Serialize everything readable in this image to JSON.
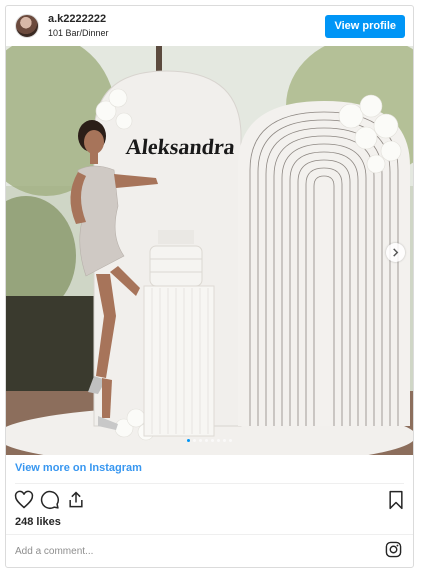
{
  "header": {
    "username": "a.k2222222",
    "subtitle": "101 Bar/Dinner",
    "view_profile_label": "View profile"
  },
  "media": {
    "overlay_text": "Aleksandra",
    "carousel_dots": 8,
    "active_dot": 1
  },
  "footer": {
    "view_more_label": "View more on Instagram",
    "likes_label": "248 likes",
    "comment_placeholder": "Add a comment..."
  },
  "icons": {
    "avatar": "avatar",
    "next": "chevron-right-icon",
    "like": "heart-icon",
    "comment": "comment-icon",
    "share": "share-icon",
    "save": "bookmark-icon",
    "logo": "instagram-icon"
  },
  "colors": {
    "accent": "#0095f6",
    "link": "#3897f0",
    "border": "#dbdbdb"
  }
}
